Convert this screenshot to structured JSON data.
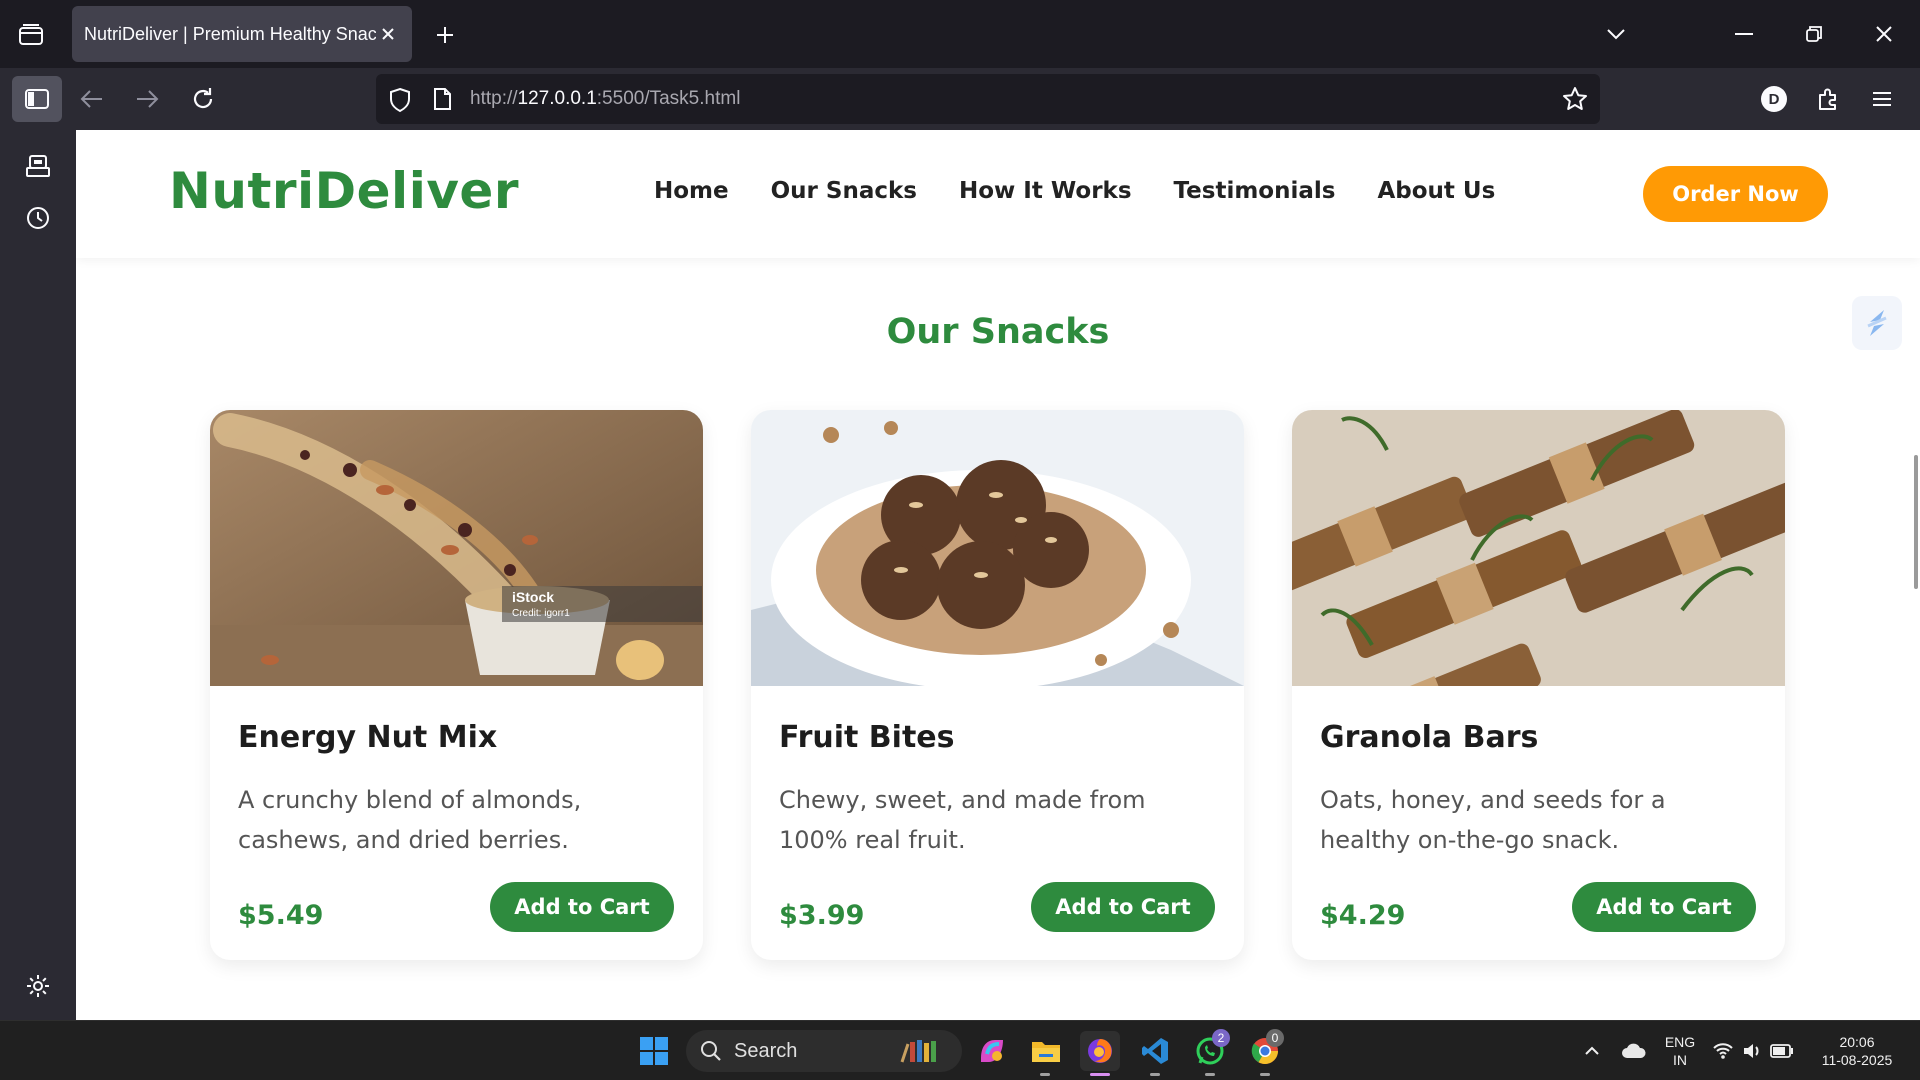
{
  "browser": {
    "tab_title": "NutriDeliver | Premium Healthy Snacks",
    "url_prefix": "http://",
    "url_host": "127.0.0.1",
    "url_rest": ":5500/Task5.html",
    "account_initial": "D"
  },
  "site": {
    "logo": "NutriDeliver",
    "nav": [
      "Home",
      "Our Snacks",
      "How It Works",
      "Testimonials",
      "About Us"
    ],
    "order_button": "Order Now",
    "section_title": "Our Snacks",
    "products": [
      {
        "name": "Energy Nut Mix",
        "description": "A crunchy blend of almonds, cashews, and dried berries.",
        "price": "$5.49",
        "button": "Add to Cart",
        "image_watermark": "iStock",
        "image_credit": "Credit: igorr1"
      },
      {
        "name": "Fruit Bites",
        "description": "Chewy, sweet, and made from 100% real fruit.",
        "price": "$3.99",
        "button": "Add to Cart"
      },
      {
        "name": "Granola Bars",
        "description": "Oats, honey, and seeds for a healthy on-the-go snack.",
        "price": "$4.29",
        "button": "Add to Cart"
      }
    ]
  },
  "taskbar": {
    "search_label": "Search",
    "whatsapp_badge": "2",
    "chrome_badge": "0",
    "language": "ENG",
    "region": "IN",
    "time": "20:06",
    "date": "11-08-2025"
  },
  "colors": {
    "brand_green": "#2e8b3e",
    "order_orange": "#ff9a05"
  }
}
